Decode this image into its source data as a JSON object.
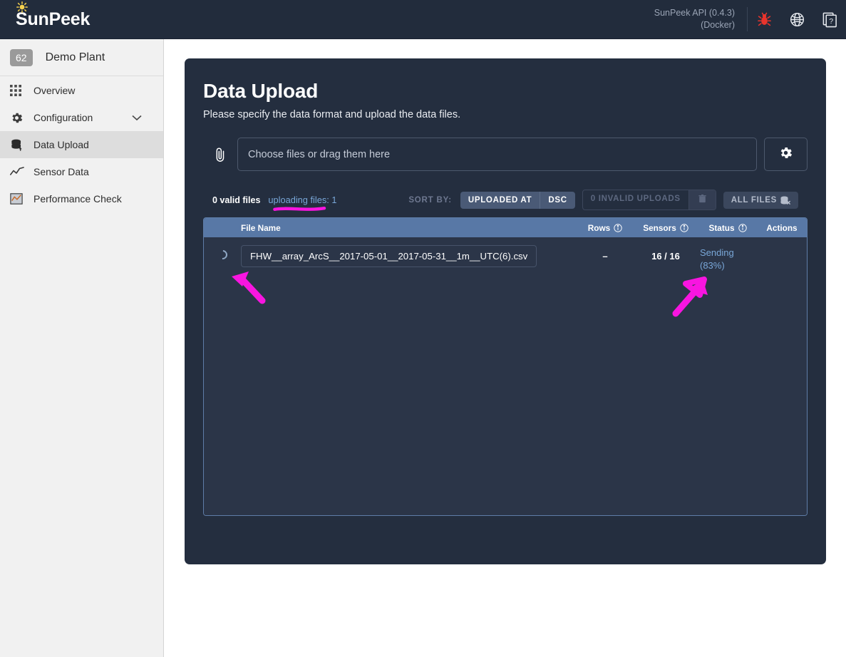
{
  "header": {
    "brand": "SunPeek",
    "sun_icon": "sun-icon",
    "api_line1": "SunPeek API (0.4.3)",
    "api_line2": "(Docker)",
    "icons": [
      {
        "name": "bug-icon",
        "color": "#e8342c"
      },
      {
        "name": "globe-icon",
        "color": "#e6e9ee"
      },
      {
        "name": "help-docs-icon",
        "color": "#e6e9ee"
      }
    ]
  },
  "sidebar": {
    "plant": {
      "badge": "62",
      "name": "Demo Plant"
    },
    "items": [
      {
        "label": "Overview",
        "icon": "grid-icon",
        "active": false,
        "chevron": false
      },
      {
        "label": "Configuration",
        "icon": "gear-icon",
        "active": false,
        "chevron": true
      },
      {
        "label": "Data Upload",
        "icon": "database-upload-icon",
        "active": true,
        "chevron": false
      },
      {
        "label": "Sensor Data",
        "icon": "line-chart-icon",
        "active": false,
        "chevron": false
      },
      {
        "label": "Performance Check",
        "icon": "chart-box-icon",
        "active": false,
        "chevron": false
      }
    ]
  },
  "main": {
    "title": "Data Upload",
    "subtitle": "Please specify the data format and upload the data files.",
    "upload": {
      "clip_icon": "paperclip-icon",
      "placeholder": "Choose files or drag them here",
      "settings_icon": "gear-icon"
    },
    "status_strip": {
      "valid_files": "0 valid files",
      "uploading_files": "uploading files: 1",
      "sort_label": "SORT BY:",
      "sort_field": "UPLOADED AT",
      "sort_dir": "DSC",
      "invalid_uploads": "0 INVALID UPLOADS",
      "delete_icon": "trash-icon",
      "all_files": "ALL FILES",
      "all_files_icon": "filter-clear-icon"
    },
    "table": {
      "columns": [
        {
          "key": "spin",
          "label": ""
        },
        {
          "key": "name",
          "label": "File Name"
        },
        {
          "key": "rows",
          "label": "Rows",
          "info": true
        },
        {
          "key": "sensors",
          "label": "Sensors",
          "info": true
        },
        {
          "key": "status",
          "label": "Status",
          "info": true
        },
        {
          "key": "actions",
          "label": "Actions"
        }
      ],
      "rows": [
        {
          "spinner": "loading-spinner",
          "file_name": "FHW__array_ArcS__2017-05-01__2017-05-31__1m__UTC(6).csv",
          "rows": "–",
          "sensors": "16 / 16",
          "status": "Sending",
          "status_pct": "(83%)",
          "actions": ""
        }
      ]
    }
  },
  "annotations": {
    "color": "#f815e0",
    "items": [
      "underline-uploading-files",
      "arrow-to-spinner",
      "arrow-to-status"
    ]
  },
  "colors": {
    "topbar": "#222c3c",
    "panel": "#242e3f",
    "table_header": "#5878a6",
    "table_body": "#2b3548",
    "accent_link": "#79a7d8",
    "annotation": "#f815e0"
  }
}
